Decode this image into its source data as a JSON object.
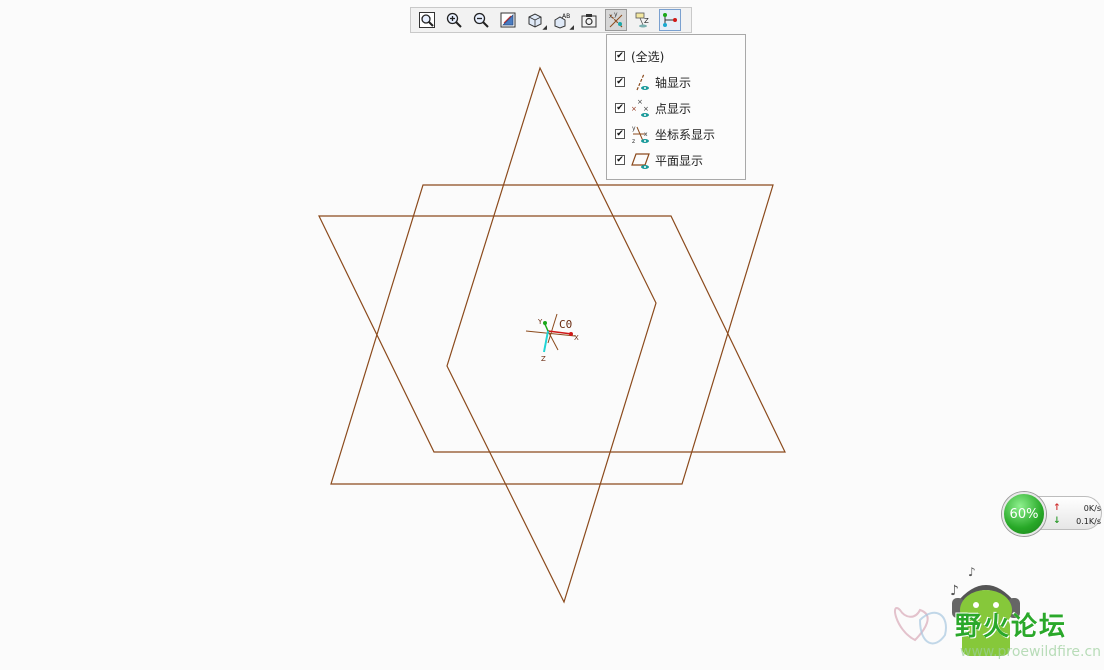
{
  "toolbar": {
    "buttons": [
      {
        "name": "zoom-fit-icon"
      },
      {
        "name": "zoom-in-icon"
      },
      {
        "name": "zoom-out-icon"
      },
      {
        "name": "repaint-icon"
      },
      {
        "name": "view-orientation-icon"
      },
      {
        "name": "saved-views-icon"
      },
      {
        "name": "display-style-icon"
      },
      {
        "name": "datum-display-filter-icon"
      },
      {
        "name": "annotation-display-icon"
      },
      {
        "name": "spin-center-icon"
      }
    ]
  },
  "dropdown": {
    "items": [
      {
        "label": "(全选)",
        "checked": true,
        "icon": "none"
      },
      {
        "label": "轴显示",
        "checked": true,
        "icon": "axis-display-icon"
      },
      {
        "label": "点显示",
        "checked": true,
        "icon": "point-display-icon"
      },
      {
        "label": "坐标系显示",
        "checked": true,
        "icon": "csys-display-icon"
      },
      {
        "label": "平面显示",
        "checked": true,
        "icon": "plane-display-icon"
      }
    ],
    "check_glyph": "✔"
  },
  "viewport": {
    "csys_label": "C0",
    "axis_x": "X",
    "axis_y": "Y",
    "axis_z": "Z",
    "plane_color": "#8b4a1c"
  },
  "network": {
    "percent": "60%",
    "upload": "0K/s",
    "download": "0.1K/s"
  },
  "watermark": {
    "title": "野火论坛",
    "url": "www.proewildfire.cn"
  }
}
